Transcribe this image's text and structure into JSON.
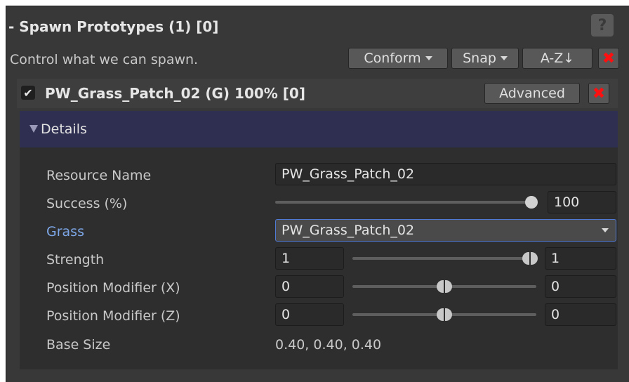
{
  "header": {
    "title": "- Spawn Prototypes (1) [0]",
    "help_label": "?",
    "description": "Control what we can spawn."
  },
  "toolbar": {
    "conform_label": "Conform",
    "snap_label": "Snap",
    "sort_label": "A-Z↓",
    "remove_label": "✖"
  },
  "prototype": {
    "checked": "✔",
    "title": "PW_Grass_Patch_02 (G) 100% [0]",
    "advanced_label": "Advanced",
    "remove_label": "✖"
  },
  "details": {
    "label": "Details",
    "resource_name": {
      "label": "Resource Name",
      "value": "PW_Grass_Patch_02"
    },
    "success": {
      "label": "Success (%)",
      "value": "100",
      "fraction": 1.0
    },
    "grass": {
      "label": "Grass",
      "value": "PW_Grass_Patch_02"
    },
    "strength": {
      "label": "Strength",
      "min": "1",
      "max": "1"
    },
    "pos_x": {
      "label": "Position Modifier (X)",
      "min": "0",
      "max": "0"
    },
    "pos_z": {
      "label": "Position Modifier (Z)",
      "min": "0",
      "max": "0"
    },
    "base_size": {
      "label": "Base Size",
      "value": "0.40, 0.40, 0.40"
    }
  },
  "colors": {
    "panel_bg": "#383838",
    "details_header": "#2f2f52",
    "remove_red": "#ff1010",
    "link_blue": "#7ca6e6"
  }
}
